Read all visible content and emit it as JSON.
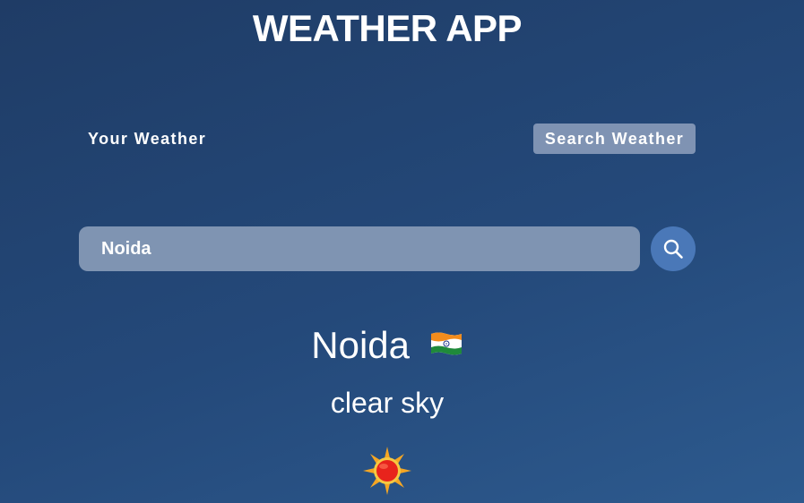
{
  "app": {
    "title": "WEATHER APP"
  },
  "tabs": {
    "your_weather": "Your Weather",
    "search_weather": "Search Weather",
    "active": "search_weather"
  },
  "search": {
    "value": "Noida",
    "button_icon": "search-icon"
  },
  "result": {
    "city": "Noida",
    "country_flag": "india-flag-icon",
    "description": "clear sky",
    "weather_icon": "sun-icon"
  },
  "colors": {
    "active_tab_bg": "#7f93b3",
    "input_bg": "#7f94b2",
    "search_button_bg": "#4a78b8",
    "sun_core": "#e8231c",
    "sun_rays": "#f5a623"
  }
}
